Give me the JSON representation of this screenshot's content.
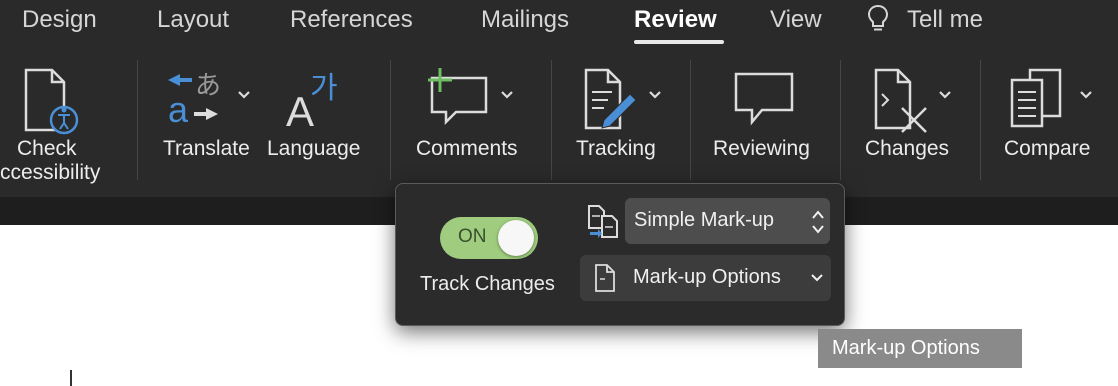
{
  "tabs": [
    {
      "label": "Design",
      "active": false
    },
    {
      "label": "Layout",
      "active": false
    },
    {
      "label": "References",
      "active": false
    },
    {
      "label": "Mailings",
      "active": false
    },
    {
      "label": "Review",
      "active": true
    },
    {
      "label": "View",
      "active": false
    }
  ],
  "tell_me": {
    "label": "Tell me",
    "icon": "lightbulb-icon"
  },
  "ribbon": {
    "check_accessibility": {
      "line1": "Check",
      "line2": "ccessibility",
      "icon": "accessibility-check-icon"
    },
    "translate": {
      "label": "Translate",
      "icon": "translate-icon"
    },
    "language": {
      "label": "Language",
      "icon": "language-icon"
    },
    "comments": {
      "label": "Comments",
      "icon": "comment-add-icon"
    },
    "tracking": {
      "label": "Tracking",
      "icon": "tracking-pencil-icon"
    },
    "reviewing": {
      "label": "Reviewing",
      "icon": "reviewing-icon"
    },
    "changes": {
      "label": "Changes",
      "icon": "changes-icon"
    },
    "compare": {
      "label": "Compare",
      "icon": "compare-icon"
    }
  },
  "tracking_popover": {
    "toggle_state": "ON",
    "track_changes_label": "Track Changes",
    "markup_view_selected": "Simple Mark-up",
    "markup_options_label": "Mark-up Options"
  },
  "tooltip": {
    "text": "Mark-up Options"
  },
  "colors": {
    "ribbon_bg": "#2a2a2a",
    "toggle_on": "#9fcc7e",
    "accent_blue": "#4a8fd6",
    "accent_green": "#6cbf5e"
  }
}
